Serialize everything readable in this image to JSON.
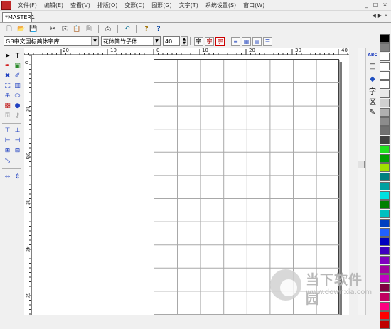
{
  "menu": [
    "文件(F)",
    "编辑(E)",
    "查看(V)",
    "排版(O)",
    "变形(C)",
    "图形(G)",
    "文字(T)",
    "系统设置(S)",
    "窗口(W)"
  ],
  "window_buttons": [
    "_",
    "□",
    "×"
  ],
  "tab": {
    "label": "*MASTER1",
    "nav": [
      "◀",
      "▶",
      "×"
    ]
  },
  "toolbar1": {
    "icons": [
      "new-file-icon",
      "open-folder-icon",
      "save-icon",
      "cut-icon",
      "copy-icon",
      "paste-icon",
      "print-preview-icon",
      "print-icon",
      "undo-icon",
      "help-icon",
      "context-help-icon"
    ],
    "glyphs": [
      "🗋",
      "📂",
      "💾",
      "✂",
      "⎘",
      "📋",
      "🗎",
      "⎙",
      "↶",
      "?",
      "?"
    ]
  },
  "toolbar2": {
    "font_chinese": "GB中文国标简体字库",
    "font_display": "花体简竹子体",
    "font_size": "40",
    "format_buttons": [
      "字",
      "字",
      "字"
    ]
  },
  "hruler_labels": [
    "20",
    "10",
    "0",
    "10",
    "20",
    "30",
    "40"
  ],
  "vruler_labels": [
    "0",
    "10",
    "20",
    "30",
    "40",
    "50"
  ],
  "right_panel": [
    "ABC",
    "□",
    "◆",
    "字",
    "区",
    "✎"
  ],
  "colors": [
    "#000000",
    "#808080",
    "#ffffff",
    "#ffffff",
    "#ffffff",
    "#ffffff",
    "#e8e8e8",
    "#d0d0d0",
    "#b0b0b0",
    "#8c8c8c",
    "#707070",
    "#404040",
    "#20e020",
    "#00a000",
    "#a0e000",
    "#008080",
    "#00a0a0",
    "#00e0e0",
    "#008000",
    "#00c0c0",
    "#0040c0",
    "#2060ff",
    "#0000c0",
    "#4000c0",
    "#8000c0",
    "#a000a0",
    "#c000c0",
    "#800040",
    "#c00060",
    "#ff0080",
    "#ff0000",
    "#c00000"
  ],
  "watermark": {
    "name": "当下软件园",
    "url": "www.downxia.com"
  }
}
